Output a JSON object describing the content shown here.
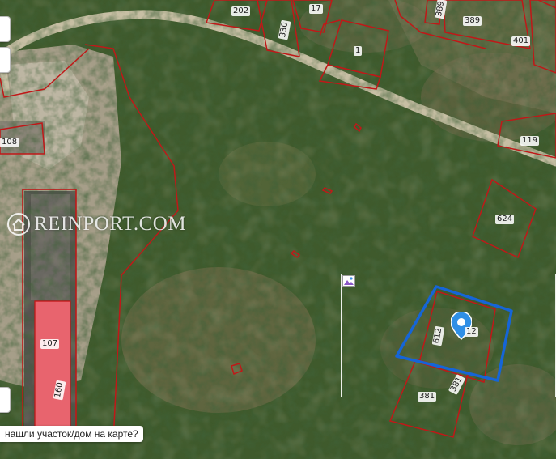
{
  "map": {
    "watermark": "REINPORT.COM",
    "hint_text": "нашли участок/дом на карте?",
    "colors": {
      "parcel_border": "#c01818",
      "selected_parcel": "#1565d8",
      "marker": "#2f8fe6",
      "highlight_fill": "#e8646e"
    },
    "parcel_labels": {
      "p202": "202",
      "p330": "330",
      "p17": "17",
      "p1": "1",
      "p389": "389",
      "p401": "401",
      "p108": "108",
      "p119": "119",
      "p624": "624",
      "p107": "107",
      "p160": "160",
      "p612": "612",
      "p12": "12",
      "p381a": "381",
      "p381b": "381"
    },
    "icons": {
      "marker": "location-pin-icon",
      "logo": "house-logo-icon",
      "image": "image-icon"
    }
  }
}
